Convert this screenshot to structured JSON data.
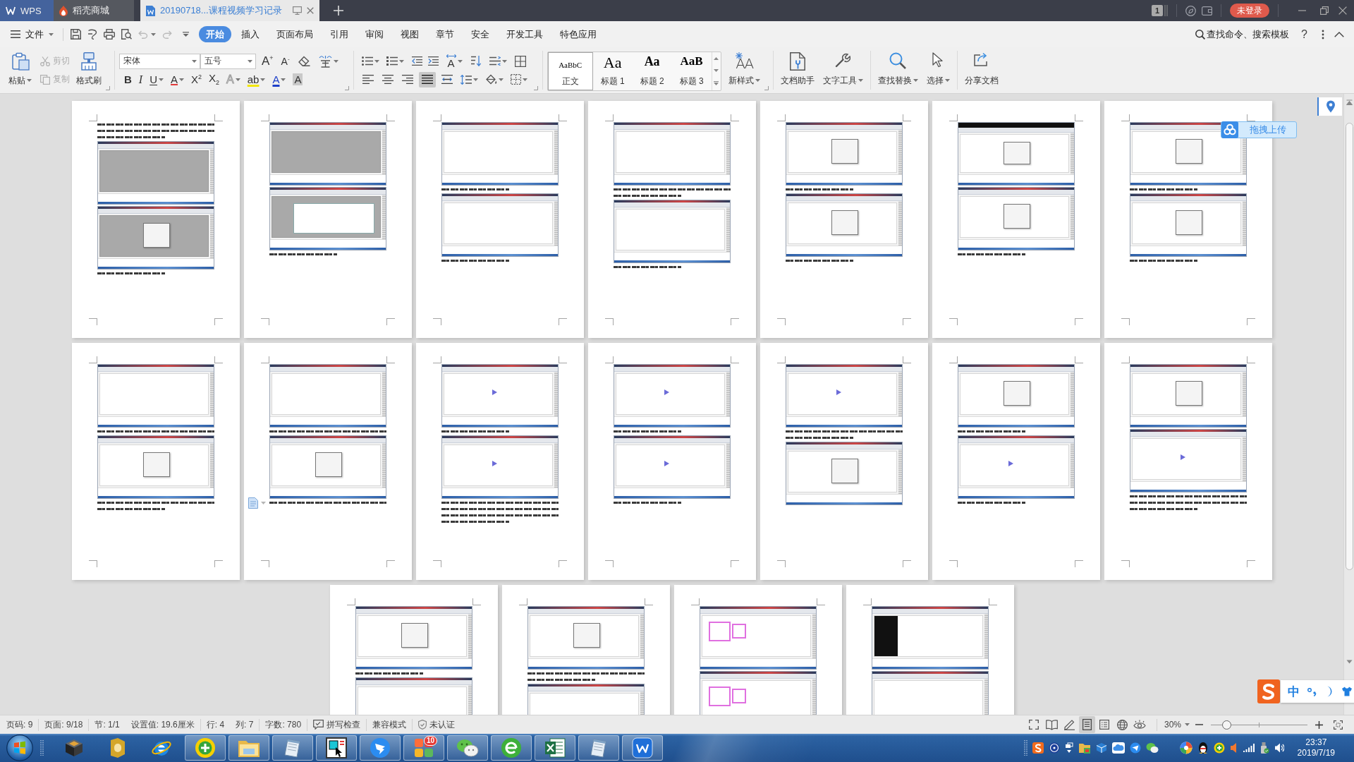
{
  "tabs": [
    {
      "kind": "app",
      "label": "WPS",
      "selected": false
    },
    {
      "kind": "store",
      "label": "稻壳商城",
      "selected": false
    },
    {
      "kind": "document",
      "label": "20190718...课程视频学习记录",
      "selected": true
    }
  ],
  "title_bar": {
    "window_count": "1",
    "login": "未登录"
  },
  "menu": {
    "file": "文件",
    "undo": {
      "disabled": true
    },
    "redo": {
      "disabled": true
    },
    "tabs": [
      {
        "label": "开始",
        "selected": true
      },
      {
        "label": "插入",
        "selected": false
      },
      {
        "label": "页面布局",
        "selected": false
      },
      {
        "label": "引用",
        "selected": false
      },
      {
        "label": "审阅",
        "selected": false
      },
      {
        "label": "视图",
        "selected": false
      },
      {
        "label": "章节",
        "selected": false
      },
      {
        "label": "安全",
        "selected": false
      },
      {
        "label": "开发工具",
        "selected": false
      },
      {
        "label": "特色应用",
        "selected": false
      }
    ],
    "search": {
      "placeholder": "查找命令、搜索模板"
    },
    "help": "?"
  },
  "ribbon": {
    "paste": "粘贴",
    "cut": {
      "label": "剪切",
      "disabled": true
    },
    "copy": {
      "label": "复制",
      "disabled": true
    },
    "format_painter": "格式刷",
    "font": {
      "name": "宋体",
      "size": "五号"
    },
    "font_buttons": [
      {
        "kind": "grow",
        "glyph": "A$^{+}$"
      },
      {
        "kind": "shrink",
        "glyph": "A$^{-}$"
      }
    ],
    "format_buttons": [
      {
        "kind": "bold",
        "glyph": "B"
      },
      {
        "kind": "italic",
        "glyph": "I"
      },
      {
        "kind": "underline",
        "glyph": "U"
      },
      {
        "kind": "strike",
        "glyph": "A"
      },
      {
        "kind": "superscript",
        "glyph": "X$^{2}$"
      },
      {
        "kind": "subscript",
        "glyph": "X$_{2}$"
      },
      {
        "kind": "effects",
        "glyph": "A"
      },
      {
        "kind": "highlight",
        "glyph": "ab"
      },
      {
        "kind": "color",
        "glyph": "A"
      },
      {
        "kind": "shading",
        "glyph": "A"
      }
    ],
    "text_direction": "A",
    "alignment": [
      {
        "selected": false
      },
      {
        "selected": false
      },
      {
        "selected": false
      },
      {
        "selected": true
      },
      {
        "selected": false
      }
    ],
    "styles": [
      {
        "kind": "body",
        "sample": "AaBbC",
        "label": "正文",
        "selected": true
      },
      {
        "kind": "heading1",
        "sample": "Aa",
        "label": "标题 1",
        "selected": false
      },
      {
        "kind": "heading2",
        "sample": "Aa",
        "label": "标题 2",
        "selected": false
      },
      {
        "kind": "heading3",
        "sample": "AaB",
        "label": "标题 3",
        "selected": false
      }
    ],
    "new_style": {
      "glyph": "AA",
      "label": "新样式"
    },
    "tools": [
      {
        "label": "文档助手"
      },
      {
        "label": "文字工具"
      },
      {
        "label": "查找替换"
      },
      {
        "label": "选择"
      },
      {
        "label": "分享文档"
      }
    ]
  },
  "document": {
    "upload": "拖拽上传",
    "pages": [
      {
        "current": false,
        "blocks": [
          {
            "kind": "text"
          },
          {
            "kind": "text"
          },
          {
            "kind": "short"
          },
          {
            "kind": "gray"
          },
          {
            "kind": "gray-dialog"
          },
          {
            "kind": "short"
          }
        ]
      },
      {
        "current": false,
        "blocks": [
          {
            "kind": "gray"
          },
          {
            "kind": "gray-panel"
          },
          {
            "kind": "short"
          }
        ]
      },
      {
        "current": false,
        "blocks": [
          {
            "kind": "white"
          },
          {
            "kind": "short"
          },
          {
            "kind": "white"
          },
          {
            "kind": "short"
          }
        ]
      },
      {
        "current": false,
        "blocks": [
          {
            "kind": "white"
          },
          {
            "kind": "text"
          },
          {
            "kind": "short"
          },
          {
            "kind": "white"
          },
          {
            "kind": "short"
          }
        ]
      },
      {
        "current": false,
        "blocks": [
          {
            "kind": "white-dialog"
          },
          {
            "kind": "short"
          },
          {
            "kind": "white-dialog"
          },
          {
            "kind": "short"
          }
        ]
      },
      {
        "current": false,
        "blocks": [
          {
            "kind": "dark-dialog"
          },
          {
            "kind": "white-dialog"
          },
          {
            "kind": "short"
          }
        ]
      },
      {
        "current": false,
        "blocks": [
          {
            "kind": "white-dialog"
          },
          {
            "kind": "short"
          },
          {
            "kind": "white-dialog"
          },
          {
            "kind": "short"
          }
        ]
      },
      {
        "current": false,
        "blocks": [
          {
            "kind": "white"
          },
          {
            "kind": "text"
          },
          {
            "kind": "white-dialog"
          },
          {
            "kind": "text"
          },
          {
            "kind": "short"
          }
        ]
      },
      {
        "current": true,
        "blocks": [
          {
            "kind": "white"
          },
          {
            "kind": "text"
          },
          {
            "kind": "white-dialog"
          },
          {
            "kind": "text"
          }
        ]
      },
      {
        "current": false,
        "blocks": [
          {
            "kind": "schematic"
          },
          {
            "kind": "short"
          },
          {
            "kind": "schematic"
          },
          {
            "kind": "text"
          },
          {
            "kind": "text"
          },
          {
            "kind": "text"
          },
          {
            "kind": "short"
          }
        ]
      },
      {
        "current": false,
        "blocks": [
          {
            "kind": "schematic"
          },
          {
            "kind": "short"
          },
          {
            "kind": "schematic"
          },
          {
            "kind": "short"
          }
        ]
      },
      {
        "current": false,
        "blocks": [
          {
            "kind": "schematic"
          },
          {
            "kind": "text"
          },
          {
            "kind": "short"
          },
          {
            "kind": "white-dialog"
          }
        ]
      },
      {
        "current": false,
        "blocks": [
          {
            "kind": "white-dialog"
          },
          {
            "kind": "short"
          },
          {
            "kind": "schematic"
          },
          {
            "kind": "short"
          }
        ]
      },
      {
        "current": false,
        "blocks": [
          {
            "kind": "white-dialog"
          },
          {
            "kind": "schematic"
          },
          {
            "kind": "text"
          },
          {
            "kind": "text"
          },
          {
            "kind": "short"
          }
        ]
      },
      {
        "current": false,
        "blocks": [
          {
            "kind": "white-dialog"
          },
          {
            "kind": "short"
          },
          {
            "kind": "white"
          }
        ]
      },
      {
        "current": false,
        "blocks": [
          {
            "kind": "white-dialog"
          },
          {
            "kind": "text"
          },
          {
            "kind": "short"
          },
          {
            "kind": "white"
          }
        ]
      },
      {
        "current": false,
        "blocks": [
          {
            "kind": "magenta"
          },
          {
            "kind": "magenta"
          }
        ]
      },
      {
        "current": false,
        "blocks": [
          {
            "kind": "terminal"
          },
          {
            "kind": "white"
          }
        ]
      }
    ]
  },
  "status": {
    "segments": [
      {
        "kind": "page",
        "text": "页码: 9"
      },
      {
        "kind": "pages",
        "text": "页面: 9/18"
      },
      {
        "kind": "section",
        "text": "节: 1/1"
      },
      {
        "kind": "setting",
        "text": "设置值: 19.6厘米"
      },
      {
        "kind": "row",
        "text": "行: 4"
      },
      {
        "kind": "column",
        "text": "列: 7"
      },
      {
        "kind": "words",
        "text": "字数: 780"
      },
      {
        "kind": "spell",
        "text": "拼写检查"
      },
      {
        "kind": "mode",
        "text": "兼容模式"
      },
      {
        "kind": "certify",
        "text": "未认证"
      }
    ],
    "views": [
      {
        "selected": false
      },
      {
        "selected": false
      },
      {
        "selected": false
      },
      {
        "selected": true
      },
      {
        "selected": false
      },
      {
        "selected": false
      },
      {
        "selected": false
      }
    ],
    "zoom": {
      "value": "30%",
      "level": 0.13
    }
  },
  "taskbar": {
    "items": [
      {
        "running": false
      },
      {
        "running": false
      },
      {
        "running": false
      },
      {
        "running": true
      },
      {
        "running": true
      },
      {
        "running": true
      },
      {
        "running": true
      },
      {
        "running": true
      },
      {
        "running": true,
        "badge": "10"
      },
      {
        "running": true
      },
      {
        "running": true
      },
      {
        "running": true
      },
      {
        "running": true
      },
      {
        "running": true
      }
    ],
    "time": "23:37",
    "date": "2019/7/19"
  },
  "ime": {
    "mode": "中"
  }
}
